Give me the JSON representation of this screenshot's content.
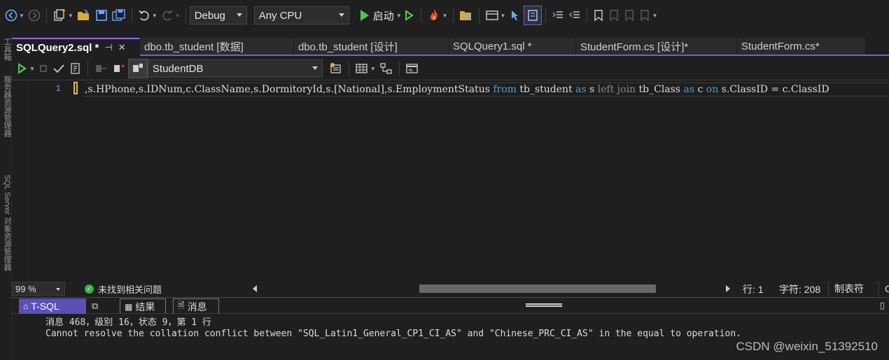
{
  "toolbar": {
    "config_combo": "Debug",
    "platform_combo": "Any CPU",
    "start_label": "启动"
  },
  "left_strip": {
    "labels": [
      "工具箱",
      "服务器资源管理器",
      "SQL Server 对象资源管理器"
    ]
  },
  "tabs": [
    {
      "label": "SQLQuery2.sql *",
      "active": true
    },
    {
      "label": "dbo.tb_student [数据]",
      "active": false
    },
    {
      "label": "dbo.tb_student [设计]",
      "active": false
    },
    {
      "label": "SQLQuery1.sql *",
      "active": false
    },
    {
      "label": "StudentForm.cs [设计]*",
      "active": false
    },
    {
      "label": "StudentForm.cs*",
      "active": false
    }
  ],
  "editor_toolbar": {
    "database": "StudentDB"
  },
  "editor": {
    "line_number": "1",
    "code_segments": [
      {
        "text": ",s.HPhone,s.IDNum,c.ClassName,s.DormitoryId,s.[National],s.EmploymentStatus ",
        "cls": ""
      },
      {
        "text": "from",
        "cls": "kw"
      },
      {
        "text": " tb_student ",
        "cls": ""
      },
      {
        "text": "as",
        "cls": "kw"
      },
      {
        "text": " s ",
        "cls": ""
      },
      {
        "text": "left join",
        "cls": "gray"
      },
      {
        "text": " tb_Class ",
        "cls": ""
      },
      {
        "text": "as",
        "cls": "kw"
      },
      {
        "text": " c ",
        "cls": ""
      },
      {
        "text": "on",
        "cls": "kw"
      },
      {
        "text": " s.ClassID = c.ClassID",
        "cls": ""
      }
    ]
  },
  "status": {
    "zoom": "99 %",
    "issues": "未找到相关问题",
    "line": "行: 1",
    "char": "字符: 208",
    "tab_mode": "制表符",
    "crlf": "C"
  },
  "panel_tabs": {
    "tsql": "T-SQL",
    "results": "结果",
    "messages": "消息"
  },
  "messages": {
    "line1": "消息 468，级别 16，状态 9，第 1 行",
    "line2": "Cannot resolve the collation conflict between \"SQL_Latin1_General_CP1_CI_AS\" and \"Chinese_PRC_CI_AS\" in the equal to operation."
  },
  "watermark": "CSDN @weixin_51392510",
  "colors": {
    "accent": "#7a5ad8",
    "keyword": "#569cd6",
    "ok": "#3fae4a",
    "tsql_tab": "#5b4fb8"
  }
}
